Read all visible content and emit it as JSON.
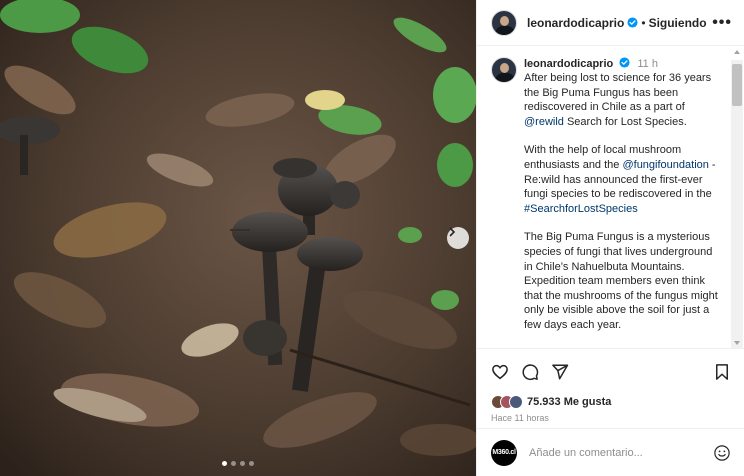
{
  "post": {
    "username": "leonardodicaprio",
    "follow_label": "Siguiendo",
    "separator": "•",
    "more_label": "•••",
    "time": "11 h",
    "caption": {
      "p1_before": "After being lost to science for 36 years the Big Puma Fungus has been rediscovered in Chile as a part of ",
      "p1_link": "@rewild",
      "p1_after": " Search for Lost Species.",
      "p2_before": "With the help of local mushroom enthusiasts and the ",
      "p2_link1": "@fungifoundation",
      "p2_mid": " - Re:wild has announced the first-ever fungi species to be rediscovered in the ",
      "p2_link2": "#SearchforLostSpecies",
      "p3": "The Big Puma Fungus is a mysterious species of fungi that lives underground in Chile’s Nahuelbuta Mountains. Expedition team members even think that the mushrooms of the fungus might only be visible above the soil for just a few days each year."
    },
    "likes": "75.933 Me gusta",
    "time_ago": "Hace 11 horas"
  },
  "comment": {
    "avatar_text": "M360.cl",
    "placeholder": "Añade un comentario..."
  },
  "carousel": {
    "slides": 4,
    "active": 1
  },
  "icons": {
    "verified": "verified-badge-icon",
    "like": "heart-icon",
    "comment": "comment-icon",
    "share": "share-icon",
    "save": "bookmark-icon",
    "emoji": "emoji-icon",
    "next": "chevron-right-icon"
  },
  "colors": {
    "verified": "#0095f6",
    "link": "#00376b",
    "muted": "#8e8e8e"
  }
}
